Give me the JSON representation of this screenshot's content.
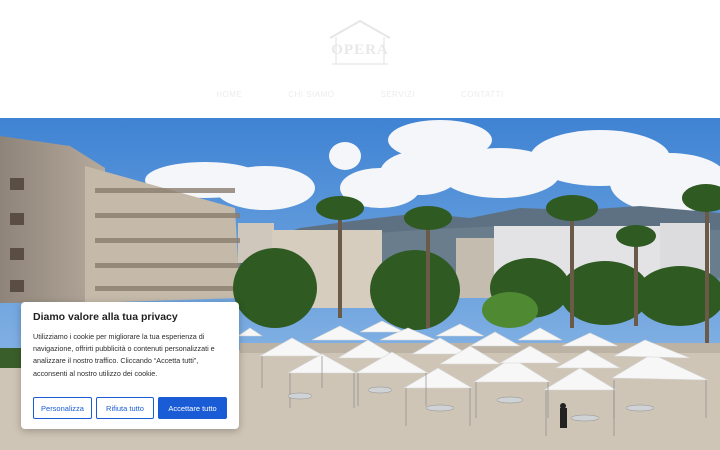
{
  "header": {
    "logo_text": "OPERA",
    "nav": [
      "Home",
      "Chi siamo",
      "Servizi",
      "Contatti"
    ]
  },
  "cookie_banner": {
    "title": "Diamo valore alla tua privacy",
    "text": "Utilizziamo i cookie per migliorare la tua esperienza di navigazione, offrirti pubblicità o contenuti personalizzati e analizzare il nostro traffico. Cliccando “Accetta tutti”, acconsenti al nostro utilizzo dei cookie.",
    "customize_label": "Personalizza",
    "reject_label": "Rifiuta tutto",
    "accept_label": "Accettare tutto"
  },
  "colors": {
    "accent": "#1a5cd6",
    "sky": "#4f8fd6",
    "tent": "#f7f7f7",
    "palm": "#2f5a22"
  }
}
